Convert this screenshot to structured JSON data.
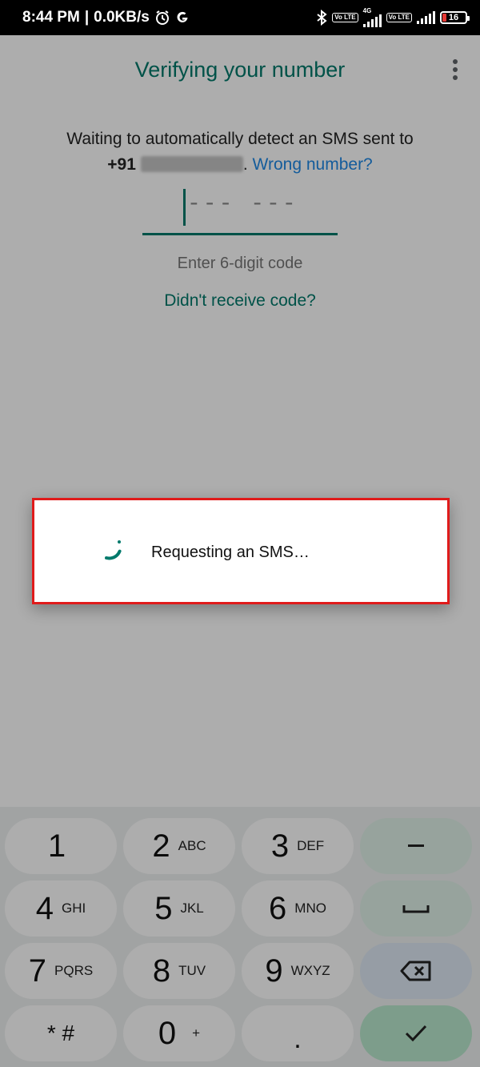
{
  "status_bar": {
    "time": "8:44 PM",
    "separator": "|",
    "speed": "0.0KB/s",
    "network_type": "4G",
    "volte_label": "Vo LTE",
    "battery": "16",
    "icons": [
      "alarm-icon",
      "google-icon",
      "bluetooth-icon",
      "signal-icon",
      "battery-icon"
    ]
  },
  "header": {
    "title": "Verifying your number"
  },
  "verification": {
    "message": "Waiting to automatically detect an SMS sent to",
    "country_code": "+91",
    "phone_number_masked": true,
    "wrong_number_link": "Wrong number?",
    "code_placeholder": "--- ---",
    "hint": "Enter 6-digit code",
    "resend_link": "Didn't receive code?"
  },
  "dialog": {
    "message": "Requesting an SMS…"
  },
  "keypad": {
    "rows": [
      [
        {
          "digit": "1",
          "letters": ""
        },
        {
          "digit": "2",
          "letters": "ABC"
        },
        {
          "digit": "3",
          "letters": "DEF"
        }
      ],
      [
        {
          "digit": "4",
          "letters": "GHI"
        },
        {
          "digit": "5",
          "letters": "JKL"
        },
        {
          "digit": "6",
          "letters": "MNO"
        }
      ],
      [
        {
          "digit": "7",
          "letters": "PQRS"
        },
        {
          "digit": "8",
          "letters": "TUV"
        },
        {
          "digit": "9",
          "letters": "WXYZ"
        }
      ],
      [
        {
          "digit": "* #",
          "letters": ""
        },
        {
          "digit": "0",
          "letters": "+"
        },
        {
          "digit": ".",
          "letters": ""
        }
      ]
    ],
    "actions": [
      "dash-key",
      "space-key",
      "backspace-key",
      "done-key"
    ],
    "colors": {
      "accent": "#00796b",
      "link": "#1e88e5",
      "highlight_border": "#e01b1b"
    }
  }
}
